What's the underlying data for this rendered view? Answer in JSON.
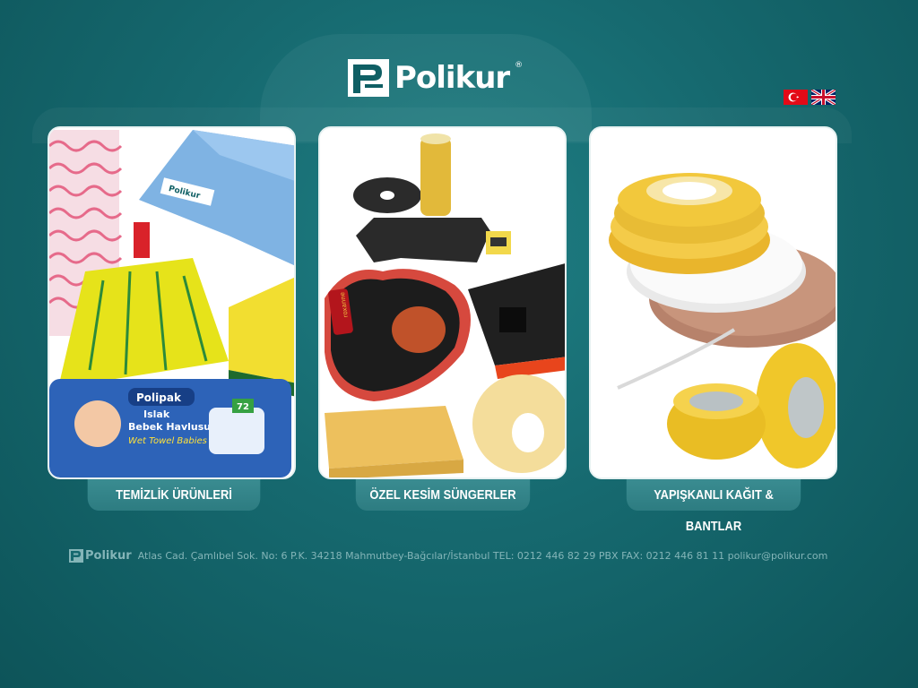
{
  "brand": {
    "name": "Polikur",
    "registered": "®"
  },
  "languages": [
    {
      "name": "Türkçe",
      "icon": "turkey-flag-icon"
    },
    {
      "name": "English",
      "icon": "uk-flag-icon"
    }
  ],
  "categories": [
    {
      "label": "TEMİZLİK ÜRÜNLERİ"
    },
    {
      "label": "ÖZEL KESİM SÜNGERLER"
    },
    {
      "label": "YAPIŞKANLI KAĞIT & BANTLAR"
    }
  ],
  "products": {
    "towel_tag": "Polikur",
    "wipes_brand": "Polipak",
    "wipes_line1": "Islak",
    "wipes_line2": "Bebek Havlusu",
    "wipes_line3": "Wet Towel Babies",
    "wipes_count": "72",
    "lipstick_brand": "roxanne"
  },
  "footer": {
    "brand": "Polikur",
    "address": "Atlas Cad. Çamlıbel Sok. No: 6 P.K. 34218 Mahmutbey-Bağcılar/İstanbul TEL: 0212 446 82 29 PBX FAX: 0212 446 81 11 polikur@polikur.com"
  },
  "colors": {
    "background": "#16696f",
    "label_bg": "#2d7c81",
    "footer_text": "#84b5b8"
  }
}
